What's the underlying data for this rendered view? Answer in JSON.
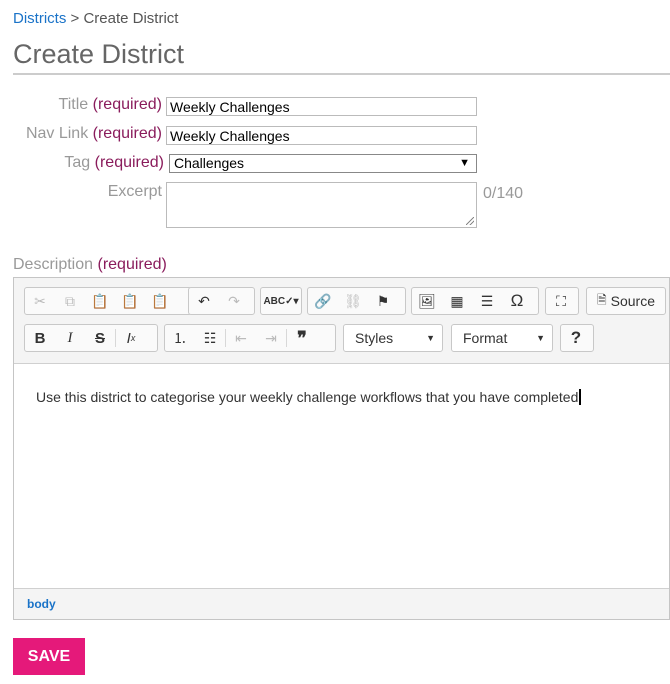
{
  "breadcrumb": {
    "parent": "Districts",
    "separator": ">",
    "current": "Create District"
  },
  "page_title": "Create District",
  "form": {
    "required_text": "(required)",
    "title": {
      "label": "Title",
      "value": "Weekly Challenges"
    },
    "nav_link": {
      "label": "Nav Link",
      "value": "Weekly Challenges"
    },
    "tag": {
      "label": "Tag",
      "value": "Challenges"
    },
    "excerpt": {
      "label": "Excerpt",
      "counter": "0/140"
    },
    "description": {
      "label": "Description"
    }
  },
  "editor": {
    "source_label": "Source",
    "styles_label": "Styles",
    "format_label": "Format",
    "content": "Use this district to categorise your weekly challenge workflows that you have completed",
    "path": "body"
  },
  "save_label": "SAVE"
}
